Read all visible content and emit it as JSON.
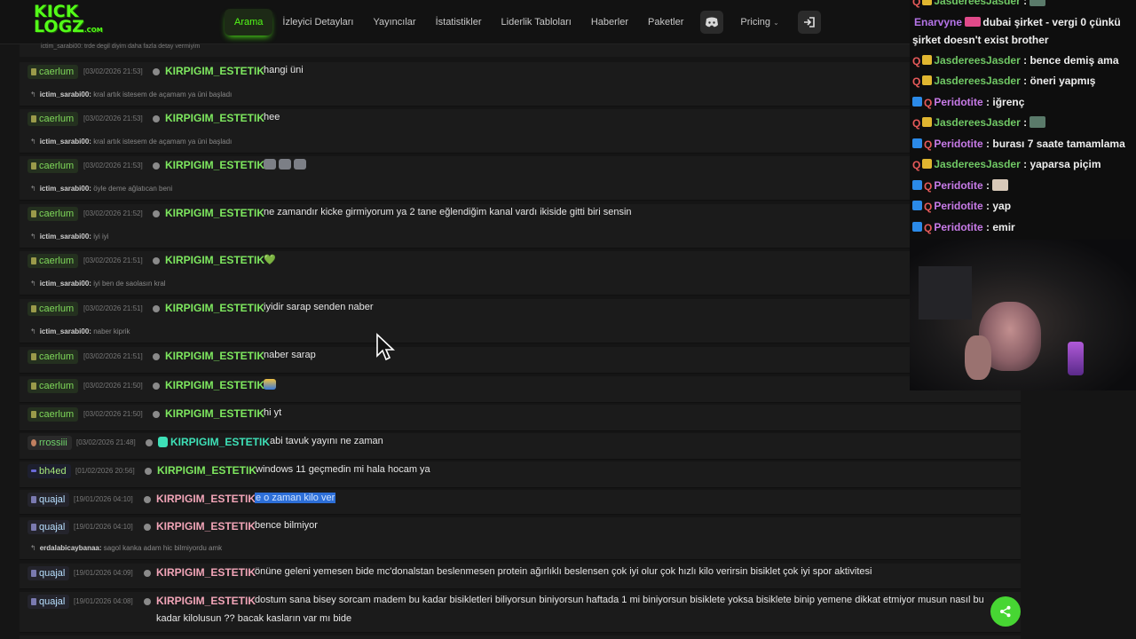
{
  "nav": {
    "logo_top": "KICK",
    "logo_bottom": "LOGZ",
    "logo_suffix": ".COM",
    "items": [
      {
        "label": "Arama",
        "active": true
      },
      {
        "label": "İzleyici Detayları"
      },
      {
        "label": "Yayıncılar"
      },
      {
        "label": "İstatistikler"
      },
      {
        "label": "Liderlik Tabloları"
      },
      {
        "label": "Haberler"
      },
      {
        "label": "Paketler"
      }
    ],
    "pricing_label": "Pricing",
    "discord_icon": "discord-icon",
    "login_icon": "login-icon"
  },
  "top_stub_text": "ictim_sarabi00: trde degil diyim daha fazla detay vermiyim",
  "messages": [
    {
      "badge": "caerlum",
      "date": "[03/02/2026 21:53]",
      "user": "KIRPIGIM_ESTETIK",
      "text": "hangi üni",
      "reply_user": "ictim_sarabi00:",
      "reply_text": "kral artık istesem de açamam ya üni başladı"
    },
    {
      "badge": "caerlum",
      "date": "[03/02/2026 21:53]",
      "user": "KIRPIGIM_ESTETIK",
      "text": "hee",
      "reply_user": "ictim_sarabi00:",
      "reply_text": "kral artık istesem de açamam ya üni başladı"
    },
    {
      "badge": "caerlum",
      "date": "[03/02/2026 21:53]",
      "user": "KIRPIGIM_ESTETIK",
      "text": "",
      "reply_user": "ictim_sarabi00:",
      "reply_text": "öyle deme ağlatıcan beni"
    },
    {
      "badge": "caerlum",
      "date": "[03/02/2026 21:52]",
      "user": "KIRPIGIM_ESTETIK",
      "text": "ne zamandır kicke girmiyorum ya 2 tane eğlendiğim kanal vardı ikiside gitti biri sensin",
      "reply_user": "ictim_sarabi00:",
      "reply_text": "iyi iyi"
    },
    {
      "badge": "caerlum",
      "date": "[03/02/2026 21:51]",
      "user": "KIRPIGIM_ESTETIK",
      "text": "💚",
      "reply_user": "ictim_sarabi00:",
      "reply_text": "iyi ben de saolasın kral"
    },
    {
      "badge": "caerlum",
      "date": "[03/02/2026 21:51]",
      "user": "KIRPIGIM_ESTETIK",
      "text": "iyidir sarap senden naber",
      "reply_user": "ictim_sarabi00:",
      "reply_text": "naber kiprik"
    },
    {
      "badge": "caerlum",
      "date": "[03/02/2026 21:51]",
      "user": "KIRPIGIM_ESTETIK",
      "text": "naber sarap"
    },
    {
      "badge": "caerlum",
      "date": "[03/02/2026 21:50]",
      "user": "KIRPIGIM_ESTETIK",
      "text": ""
    },
    {
      "badge": "caerlum",
      "date": "[03/02/2026 21:50]",
      "user": "KIRPIGIM_ESTETIK",
      "text": "hi yt"
    },
    {
      "badge": "rrossiii",
      "date": "[03/02/2026 21:48]",
      "user": "KIRPIGIM_ESTETIK",
      "text": "abi tavuk yayını ne zaman"
    },
    {
      "badge": "bh4ed",
      "date": "[01/02/2026 20:56]",
      "user": "KIRPIGIM_ESTETIK",
      "text": "windows 11 geçmedin mi hala hocam ya"
    },
    {
      "badge": "quajal",
      "date": "[19/01/2026 04:10]",
      "user": "KIRPIGIM_ESTETIK",
      "text": "e o zaman kilo ver"
    },
    {
      "badge": "quajal",
      "date": "[19/01/2026 04:10]",
      "user": "KIRPIGIM_ESTETIK",
      "text": "bence bilmiyor",
      "reply_user": "erdalabicaybanaa:",
      "reply_text": "sagol kanka adam hic bilmiyordu amk"
    },
    {
      "badge": "quajal",
      "date": "[19/01/2026 04:09]",
      "user": "KIRPIGIM_ESTETIK",
      "text": "önüne geleni yemesen bide mc'donalstan beslenmesen protein ağırlıklı beslensen çok iyi olur çok hızlı kilo verirsin bisiklet çok iyi spor aktivitesi"
    },
    {
      "badge": "quajal",
      "date": "[19/01/2026 04:08]",
      "user": "KIRPIGIM_ESTETIK",
      "text": "dostum sana bisey sorcam madem bu kadar bisikletleri biliyorsun biniyorsun haftada 1 mi biniyorsun bisiklete yoksa bisiklete binip yemene dikkat etmiyor musun nasıl bu",
      "text2": "kadar kilolusun ?? bacak kasların var mı bide"
    }
  ],
  "overlay_chat": [
    {
      "name": "JasdereesJasder",
      "msg": ":",
      "emote": true
    },
    {
      "name": "Enarvyne",
      "msg": "dubai şirket - vergi 0 çünkü",
      "msg2": "şirket doesn't exist brother"
    },
    {
      "name": "JasdereesJasder",
      "msg": ": bence demiş ama"
    },
    {
      "name": "JasdereesJasder",
      "msg": ": öneri yapmış"
    },
    {
      "name": "Peridotite",
      "msg": ": iğrenç"
    },
    {
      "name": "JasdereesJasder",
      "msg": ":",
      "emote": true
    },
    {
      "name": "Peridotite",
      "msg": ": burası 7 saate tamamlama"
    },
    {
      "name": "JasdereesJasder",
      "msg": ": yaparsa piçim"
    },
    {
      "name": "Peridotite",
      "msg": ":",
      "emote": true
    },
    {
      "name": "Peridotite",
      "msg": ": yap"
    },
    {
      "name": "Peridotite",
      "msg": ": emir"
    }
  ],
  "colors": {
    "accent": "#53fc18",
    "user_green": "#7ee85f",
    "user_pink": "#f2a5b8",
    "highlight": "#2d6fd8"
  }
}
